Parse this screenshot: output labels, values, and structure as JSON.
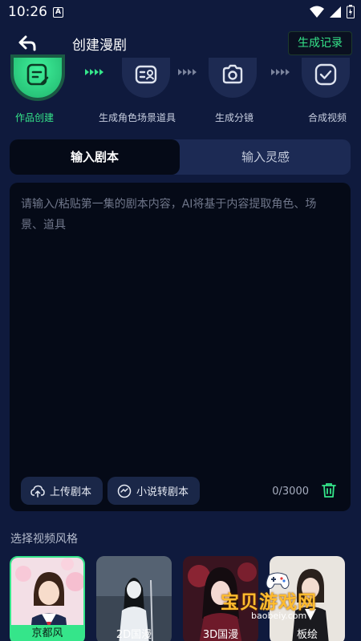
{
  "status": {
    "time": "10:26",
    "indicator": "A"
  },
  "header": {
    "title": "创建漫剧",
    "records_label": "生成记录"
  },
  "steps": [
    {
      "label": "作品创建",
      "icon": "edit-doc-icon",
      "active": true
    },
    {
      "label": "生成角色场景道具",
      "icon": "character-card-icon",
      "active": false
    },
    {
      "label": "生成分镜",
      "icon": "camera-icon",
      "active": false
    },
    {
      "label": "合成视频",
      "icon": "check-icon",
      "active": false
    }
  ],
  "tabs": [
    {
      "label": "输入剧本",
      "active": true
    },
    {
      "label": "输入灵感",
      "active": false
    }
  ],
  "editor": {
    "placeholder": "请输入/粘贴第一集的剧本内容，AI将基于内容提取角色、场景、道具",
    "value": "",
    "upload_label": "上传剧本",
    "convert_label": "小说转剧本",
    "counter": "0/3000"
  },
  "style_section": {
    "label": "选择视频风格",
    "options": [
      {
        "name": "京都风",
        "selected": true
      },
      {
        "name": "2D国漫",
        "selected": false
      },
      {
        "name": "3D国漫",
        "selected": false
      },
      {
        "name": "板绘",
        "selected": false
      }
    ]
  },
  "watermark": {
    "text": "宝贝游戏网",
    "url": "baobeiy.com"
  },
  "colors": {
    "accent": "#35e58a",
    "background": "#0f1a3d",
    "panel": "#050a17"
  }
}
